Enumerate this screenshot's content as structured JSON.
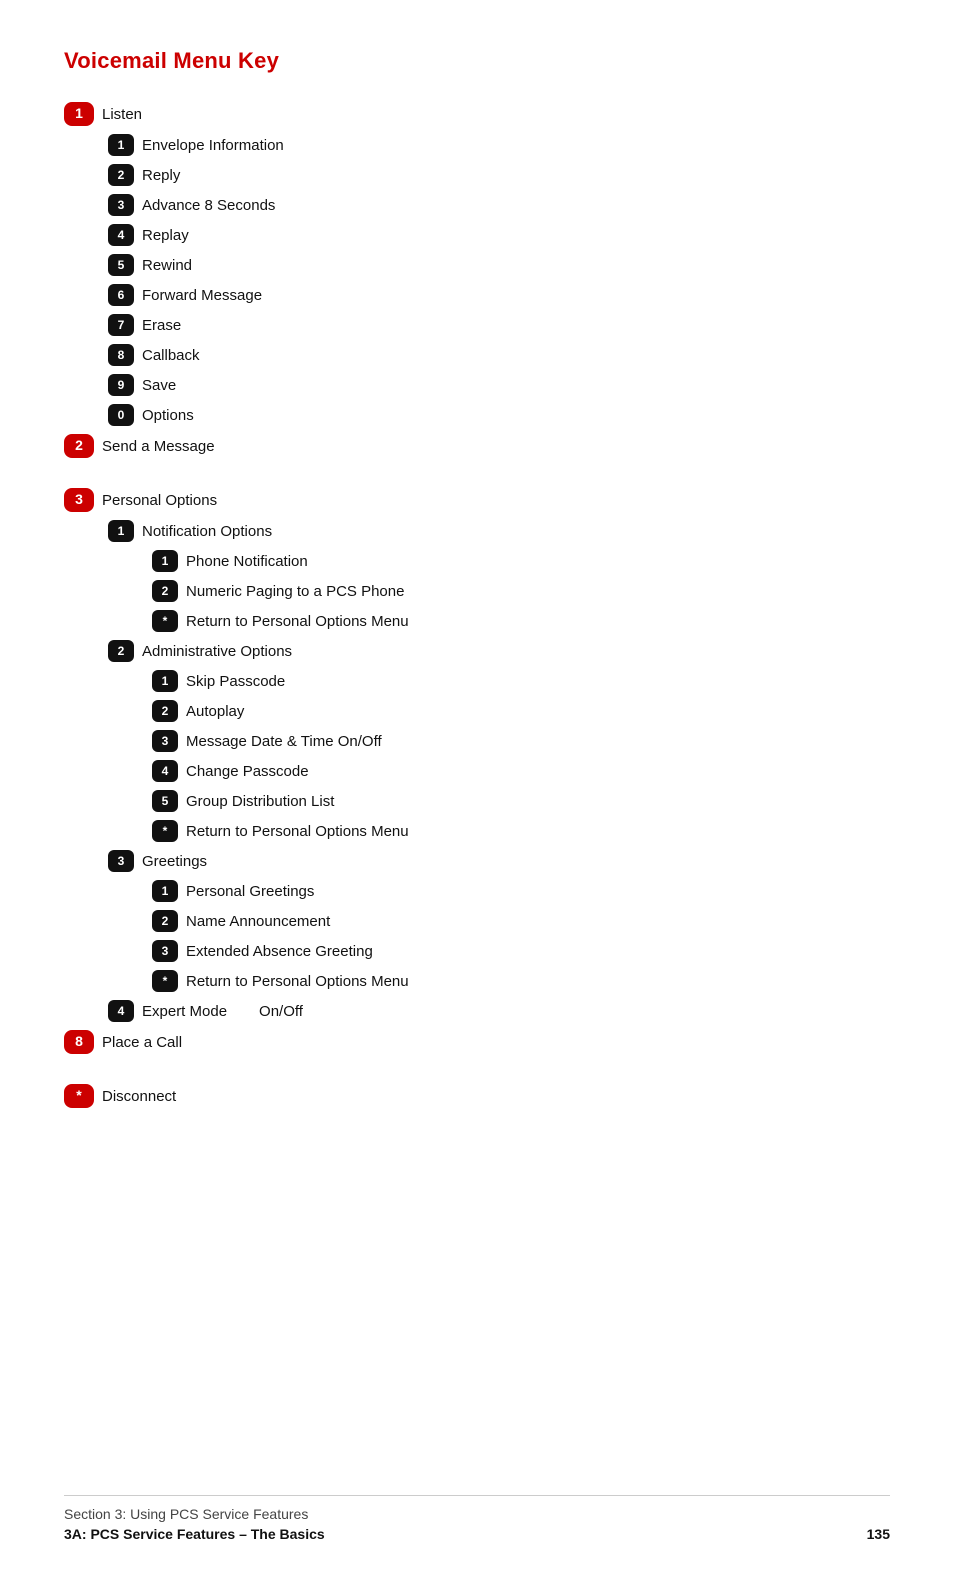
{
  "title": "Voicemail Menu Key",
  "footer": {
    "section_label": "Section 3: Using PCS Service Features",
    "chapter": "3A: PCS Service Features – The Basics",
    "page": "135"
  },
  "menu": [
    {
      "badge": "1",
      "badge_color": "red",
      "text": "Listen",
      "indent": 0,
      "children": [
        {
          "badge": "1",
          "text": "Envelope Information",
          "indent": 1
        },
        {
          "badge": "2",
          "text": "Reply",
          "indent": 1
        },
        {
          "badge": "3",
          "text": "Advance 8 Seconds",
          "indent": 1
        },
        {
          "badge": "4",
          "text": "Replay",
          "indent": 1
        },
        {
          "badge": "5",
          "text": "Rewind",
          "indent": 1
        },
        {
          "badge": "6",
          "text": "Forward Message",
          "indent": 1
        },
        {
          "badge": "7",
          "text": "Erase",
          "indent": 1
        },
        {
          "badge": "8",
          "text": "Callback",
          "indent": 1
        },
        {
          "badge": "9",
          "text": "Save",
          "indent": 1
        },
        {
          "badge": "0",
          "text": "Options",
          "indent": 1
        }
      ]
    },
    {
      "badge": "2",
      "badge_color": "red",
      "text": "Send a Message",
      "indent": 0,
      "spacer": true
    },
    {
      "badge": "3",
      "badge_color": "red",
      "text": "Personal Options",
      "indent": 0,
      "children": [
        {
          "badge": "1",
          "text": "Notification Options",
          "indent": 1,
          "children": [
            {
              "badge": "1",
              "text": "Phone Notification",
              "indent": 2
            },
            {
              "badge": "2",
              "text": "Numeric Paging to a PCS Phone",
              "indent": 2
            },
            {
              "badge": "*",
              "text": "Return to Personal Options Menu",
              "indent": 2
            }
          ]
        },
        {
          "badge": "2",
          "text": "Administrative Options",
          "indent": 1,
          "children": [
            {
              "badge": "1",
              "text": "Skip Passcode",
              "indent": 2
            },
            {
              "badge": "2",
              "text": "Autoplay",
              "indent": 2
            },
            {
              "badge": "3",
              "text": "Message Date & Time On/Off",
              "indent": 2
            },
            {
              "badge": "4",
              "text": "Change Passcode",
              "indent": 2
            },
            {
              "badge": "5",
              "text": "Group Distribution List",
              "indent": 2
            },
            {
              "badge": "*",
              "text": "Return to Personal Options Menu",
              "indent": 2
            }
          ]
        },
        {
          "badge": "3",
          "text": "Greetings",
          "indent": 1,
          "children": [
            {
              "badge": "1",
              "text": "Personal Greetings",
              "indent": 2
            },
            {
              "badge": "2",
              "text": "Name Announcement",
              "indent": 2
            },
            {
              "badge": "3",
              "text": "Extended Absence Greeting",
              "indent": 2
            },
            {
              "badge": "*",
              "text": "Return to Personal Options Menu",
              "indent": 2
            }
          ]
        },
        {
          "badge": "4",
          "text": "Expert Mode",
          "indent": 1,
          "on_off": "On/Off"
        }
      ]
    },
    {
      "badge": "8",
      "badge_color": "red",
      "text": "Place a Call",
      "indent": 0,
      "spacer": true
    },
    {
      "badge": "*",
      "badge_color": "red",
      "text": "Disconnect",
      "indent": 0
    }
  ]
}
